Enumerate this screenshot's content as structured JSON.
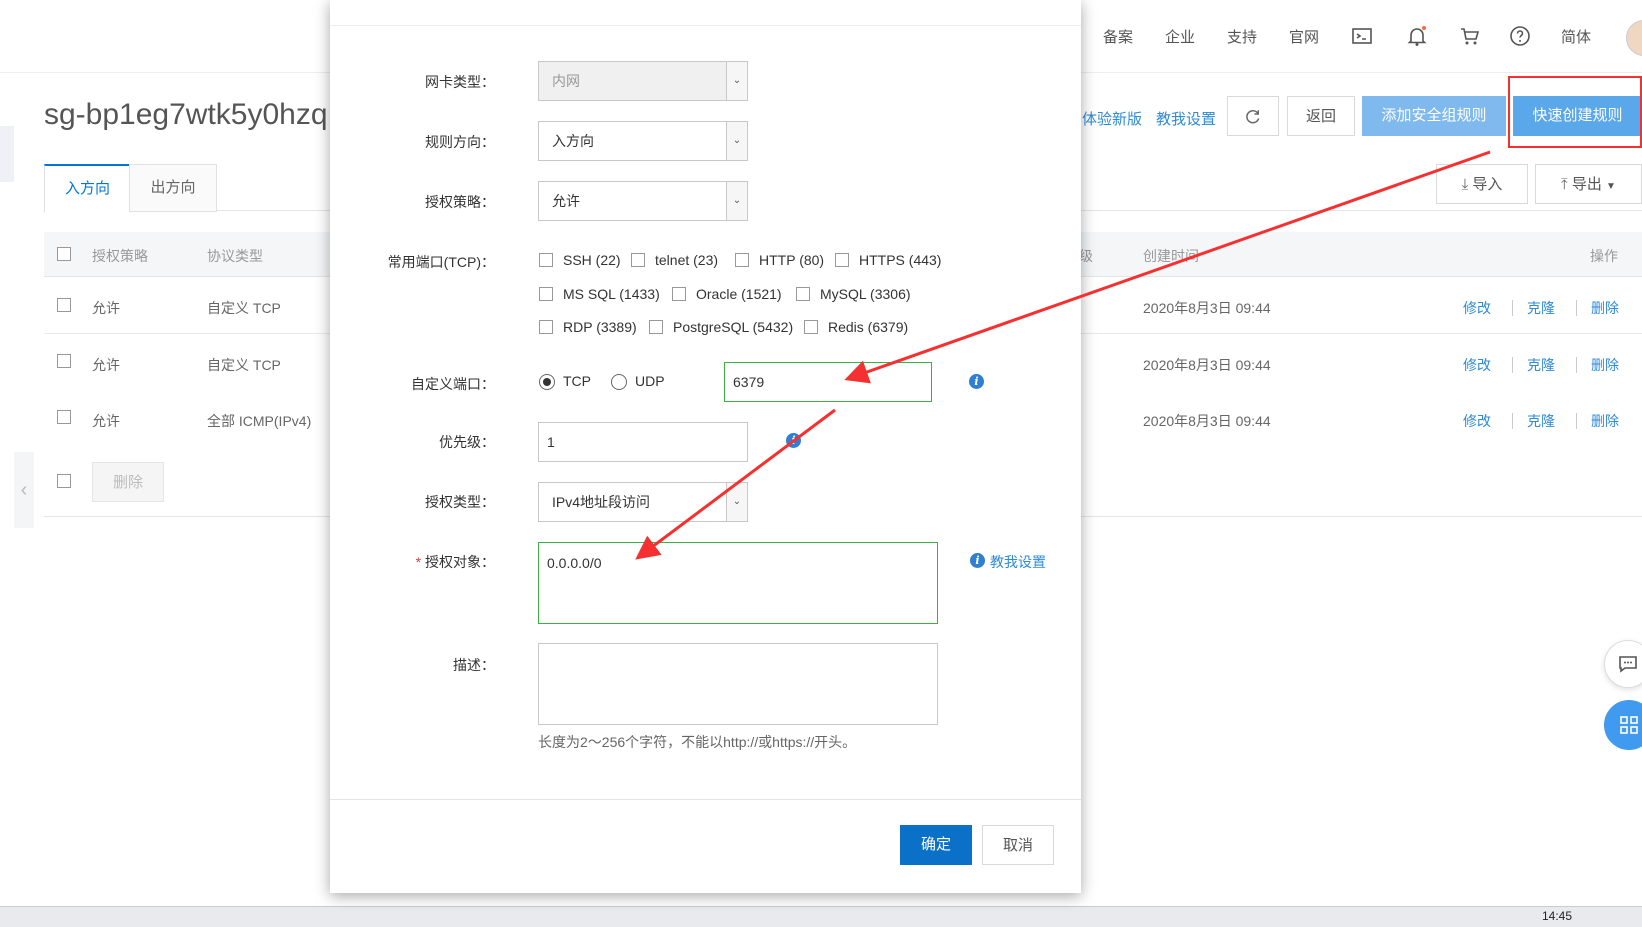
{
  "topnav": {
    "items": [
      "备案",
      "企业",
      "支持",
      "官网"
    ],
    "lang": "简体"
  },
  "page": {
    "title": "sg-bp1eg7wtk5y0hzq",
    "tabs": [
      "入方向",
      "出方向"
    ],
    "links": [
      "体验新版",
      "教我设置"
    ],
    "buttons": {
      "back": "返回",
      "add_rule": "添加安全组规则",
      "quick_create": "快速创建规则",
      "import": "导入",
      "export": "导出"
    },
    "table": {
      "headers": [
        "授权策略",
        "协议类型",
        "级",
        "创建时间",
        "操作"
      ],
      "rows": [
        {
          "policy": "允许",
          "protocol": "自定义 TCP",
          "created": "2020年8月3日 09:44"
        },
        {
          "policy": "允许",
          "protocol": "自定义 TCP",
          "created": "2020年8月3日 09:44"
        },
        {
          "policy": "允许",
          "protocol": "全部 ICMP(IPv4)",
          "created": "2020年8月3日 09:44"
        }
      ],
      "actions": [
        "修改",
        "克隆",
        "删除"
      ],
      "delete_button": "删除"
    }
  },
  "modal": {
    "nic_type": {
      "label": "网卡类型：",
      "value": "内网"
    },
    "direction": {
      "label": "规则方向：",
      "value": "入方向"
    },
    "policy": {
      "label": "授权策略：",
      "value": "允许"
    },
    "common_ports": {
      "label": "常用端口(TCP)：",
      "options": [
        "SSH (22)",
        "telnet (23)",
        "HTTP (80)",
        "HTTPS (443)",
        "MS SQL (1433)",
        "Oracle (1521)",
        "MySQL (3306)",
        "RDP (3389)",
        "PostgreSQL (5432)",
        "Redis (6379)"
      ]
    },
    "custom_port": {
      "label": "自定义端口：",
      "protocols": [
        "TCP",
        "UDP"
      ],
      "selected": "TCP",
      "value": "6379"
    },
    "priority": {
      "label": "优先级：",
      "value": "1"
    },
    "auth_type": {
      "label": "授权类型：",
      "value": "IPv4地址段访问"
    },
    "auth_object": {
      "required_mark": "*",
      "label": "授权对象：",
      "value": "0.0.0.0/0",
      "help_link": "教我设置"
    },
    "description": {
      "label": "描述：",
      "value": "",
      "hint": "长度为2～256个字符，不能以http://或https://开头。"
    },
    "confirm": "确定",
    "cancel": "取消"
  },
  "taskbar": {
    "time": "14:45"
  },
  "colors": {
    "accent": "#0076d6",
    "annotation_red": "#f53030",
    "valid_green": "#3cb043"
  }
}
